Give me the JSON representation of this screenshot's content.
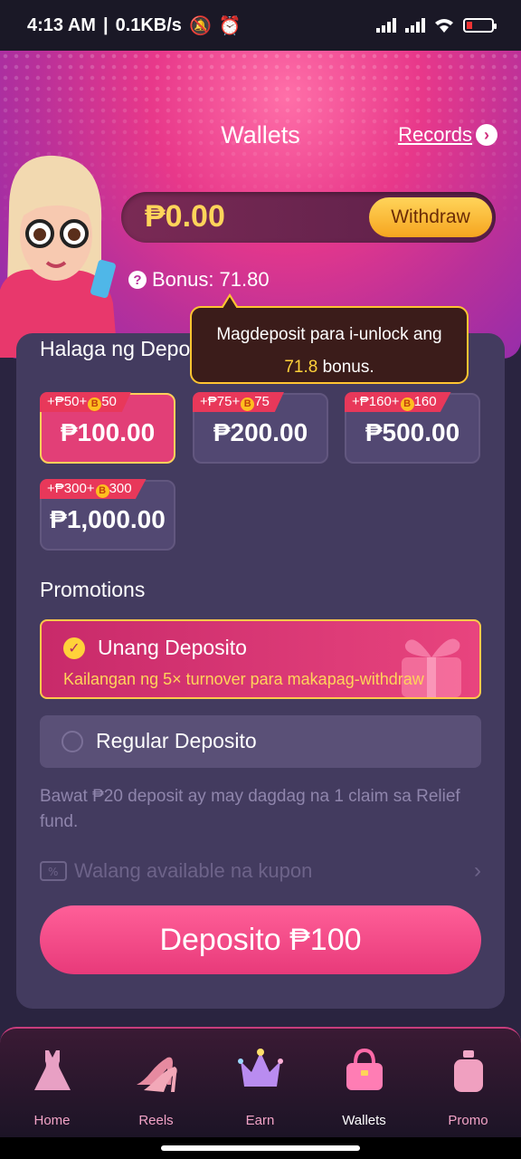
{
  "status_bar": {
    "time": "4:13 AM",
    "speed": "0.1KB/s"
  },
  "header": {
    "title": "Wallets",
    "records_label": "Records"
  },
  "balance": {
    "amount": "₱0.00",
    "withdraw_label": "Withdraw",
    "bonus_label": "Bonus:",
    "bonus_value": "71.80"
  },
  "tooltip": {
    "line1": "Magdeposit para i-unlock ang",
    "amount": "71.8",
    "suffix": "bonus."
  },
  "deposit": {
    "section_label": "Halaga ng Deposito",
    "amounts": [
      {
        "value": "₱100.00",
        "tag_a": "+₱50+",
        "tag_b": "50",
        "selected": true
      },
      {
        "value": "₱200.00",
        "tag_a": "+₱75+",
        "tag_b": "75",
        "selected": false
      },
      {
        "value": "₱500.00",
        "tag_a": "+₱160+",
        "tag_b": "160",
        "selected": false
      },
      {
        "value": "₱1,000.00",
        "tag_a": "+₱300+",
        "tag_b": "300",
        "selected": false
      }
    ],
    "coin_letter": "B"
  },
  "promotions": {
    "label": "Promotions",
    "first": {
      "title": "Unang Deposito",
      "subtitle": "Kailangan ng 5× turnover para makapag-withdraw"
    },
    "regular": {
      "title": "Regular Deposito"
    }
  },
  "note": "Bawat ₱20 deposit ay may dagdag na 1 claim sa Relief fund.",
  "coupon": "Walang available na kupon",
  "deposit_button": "Deposito ₱100",
  "tabs": [
    {
      "label": "Home",
      "icon": "dress-icon"
    },
    {
      "label": "Reels",
      "icon": "heels-icon"
    },
    {
      "label": "Earn",
      "icon": "crown-icon"
    },
    {
      "label": "Wallets",
      "icon": "handbag-icon",
      "active": true
    },
    {
      "label": "Promo",
      "icon": "perfume-icon"
    }
  ],
  "colors": {
    "accent": "#e83a7a",
    "gold": "#ffd45a",
    "panel": "#433b5f"
  }
}
